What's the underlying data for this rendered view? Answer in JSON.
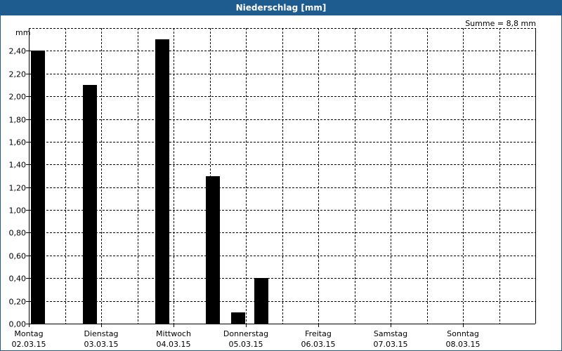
{
  "window": {
    "title": "Niederschlag [mm]"
  },
  "summary": "Summe = 8,8 mm",
  "colors": {
    "titlebar": "#1e5b8e",
    "bars": "#000000",
    "grid": "#000000"
  },
  "chart_data": {
    "type": "bar",
    "title": "Niederschlag [mm]",
    "ylabel": "mm",
    "ylim": [
      0,
      2.6
    ],
    "yticks": [
      "0,00",
      "0,20",
      "0,40",
      "0,60",
      "0,80",
      "1,00",
      "1,20",
      "1,40",
      "1,60",
      "1,80",
      "2,00",
      "2,20",
      "2,40"
    ],
    "days": [
      {
        "day": "Montag",
        "date": "02.03.15"
      },
      {
        "day": "Dienstag",
        "date": "03.03.15"
      },
      {
        "day": "Mittwoch",
        "date": "04.03.15"
      },
      {
        "day": "Donnerstag",
        "date": "05.03.15"
      },
      {
        "day": "Freitag",
        "date": "06.03.15"
      },
      {
        "day": "Samstag",
        "date": "07.03.15"
      },
      {
        "day": "Sonntag",
        "date": "08.03.15"
      }
    ],
    "series": [
      {
        "values": [
          {
            "t": 0.03,
            "v": 2.4
          },
          {
            "t": 0.75,
            "v": 2.1
          },
          {
            "t": 1.75,
            "v": 2.5
          },
          {
            "t": 2.45,
            "v": 1.3
          },
          {
            "t": 2.8,
            "v": 0.1
          },
          {
            "t": 3.12,
            "v": 0.4
          }
        ]
      }
    ],
    "grid": true
  }
}
